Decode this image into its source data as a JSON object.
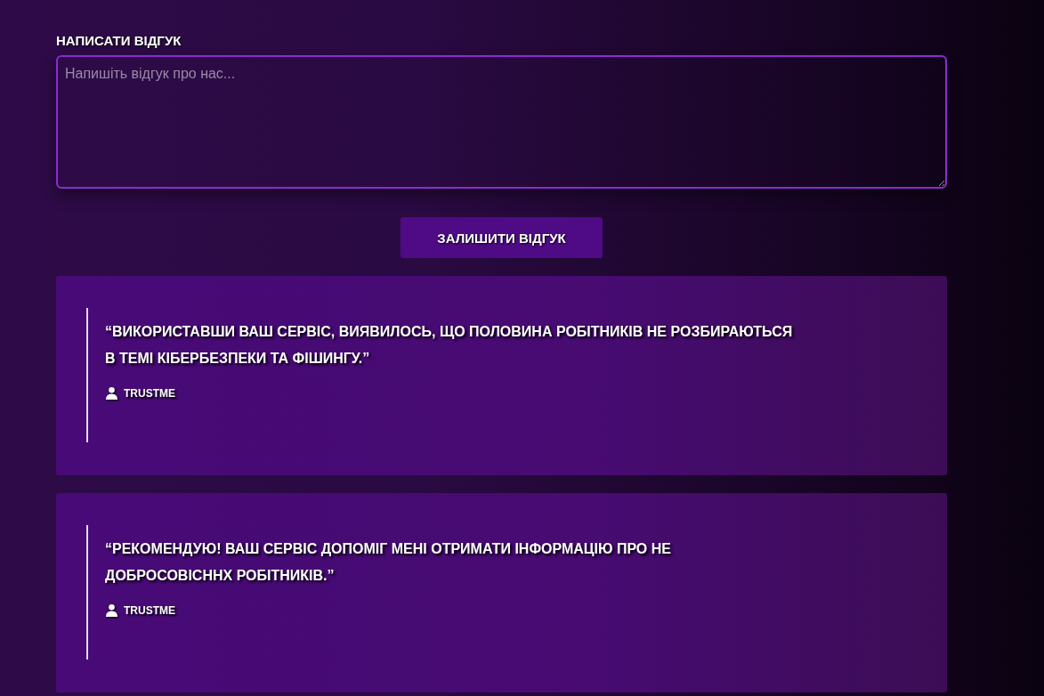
{
  "form": {
    "label": "НАПИСАТИ ВІДГУК",
    "placeholder": "Напишіть відгук про нас...",
    "submit": "ЗАЛИШИТИ ВІДГУК"
  },
  "reviews": [
    {
      "text": "“ВИКОРИСТАВШИ ВАШ СЕРВІС, ВИЯВИЛОСЬ, ЩО ПОЛОВИНА РОБІТНИКІВ НЕ РОЗБИРАЮТЬСЯ В ТЕМІ КІБЕРБЕЗПЕКИ ТА ФІШИНГУ.”",
      "author": "TRUSTME"
    },
    {
      "text": "“РЕКОМЕНДУЮ! ВАШ СЕРВІС ДОПОМІГ МЕНІ ОТРИМАТИ ІНФОРМАЦІЮ ПРО НЕ ДОБРОСОВІСННХ РОБІТНИКІВ.”",
      "author": "TRUSTME"
    }
  ]
}
